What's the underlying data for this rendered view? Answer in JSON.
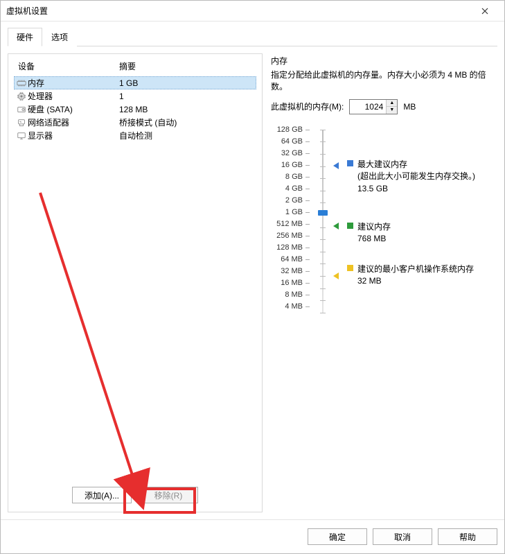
{
  "window": {
    "title": "虚拟机设置"
  },
  "tabs": {
    "hardware": "硬件",
    "options": "选项"
  },
  "device_table": {
    "headers": {
      "device": "设备",
      "summary": "摘要"
    },
    "rows": [
      {
        "icon": "memory-icon",
        "name": "内存",
        "summary": "1 GB",
        "selected": true
      },
      {
        "icon": "cpu-icon",
        "name": "处理器",
        "summary": "1",
        "selected": false
      },
      {
        "icon": "disk-icon",
        "name": "硬盘 (SATA)",
        "summary": "128 MB",
        "selected": false
      },
      {
        "icon": "network-icon",
        "name": "网络适配器",
        "summary": "桥接模式 (自动)",
        "selected": false
      },
      {
        "icon": "display-icon",
        "name": "显示器",
        "summary": "自动检测",
        "selected": false
      }
    ],
    "buttons": {
      "add": "添加(A)...",
      "remove": "移除(R)"
    }
  },
  "memory_panel": {
    "title": "内存",
    "description": "指定分配给此虚拟机的内存量。内存大小必须为 4 MB 的倍数。",
    "field_label": "此虚拟机的内存(M):",
    "value": "1024",
    "unit": "MB",
    "ticks": [
      "128 GB",
      "64 GB",
      "32 GB",
      "16 GB",
      "8 GB",
      "4 GB",
      "2 GB",
      "1 GB",
      "512 MB",
      "256 MB",
      "128 MB",
      "64 MB",
      "32 MB",
      "16 MB",
      "8 MB",
      "4 MB"
    ],
    "legend": {
      "max": {
        "label": "最大建议内存",
        "note": "(超出此大小可能发生内存交换。)",
        "value": "13.5 GB",
        "color": "#3a7ad4"
      },
      "recommended": {
        "label": "建议内存",
        "value": "768 MB",
        "color": "#2e9b3c"
      },
      "min": {
        "label": "建议的最小客户机操作系统内存",
        "value": "32 MB",
        "color": "#eec223"
      }
    }
  },
  "footer": {
    "ok": "确定",
    "cancel": "取消",
    "help": "帮助"
  }
}
